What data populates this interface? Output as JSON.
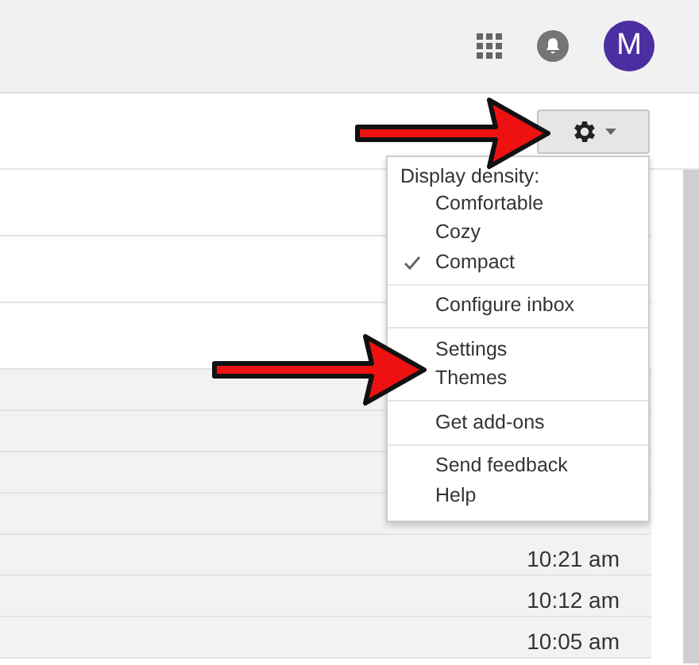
{
  "top_bar": {
    "avatar_letter": "M"
  },
  "settings_button": {
    "expanded": true
  },
  "menu": {
    "sections": [
      {
        "heading": "Display density:",
        "items": [
          {
            "label": "Comfortable",
            "selected": false
          },
          {
            "label": "Cozy",
            "selected": false
          },
          {
            "label": "Compact",
            "selected": true
          }
        ]
      },
      {
        "items": [
          {
            "label": "Configure inbox"
          }
        ]
      },
      {
        "items": [
          {
            "label": "Settings"
          },
          {
            "label": "Themes"
          }
        ]
      },
      {
        "items": [
          {
            "label": "Get add-ons"
          }
        ]
      },
      {
        "items": [
          {
            "label": "Send feedback"
          },
          {
            "label": "Help"
          }
        ]
      }
    ]
  },
  "messages": [
    {
      "unread": true
    },
    {
      "unread": true
    },
    {
      "unread": true
    },
    {
      "unread": false
    },
    {
      "unread": false
    },
    {
      "unread": false
    },
    {
      "unread": false
    },
    {
      "unread": false,
      "time": "10:21 am"
    },
    {
      "unread": false,
      "time": "10:12 am"
    },
    {
      "unread": false,
      "time": "10:05 am"
    }
  ],
  "annotations": [
    {
      "kind": "arrow"
    },
    {
      "kind": "arrow"
    }
  ]
}
